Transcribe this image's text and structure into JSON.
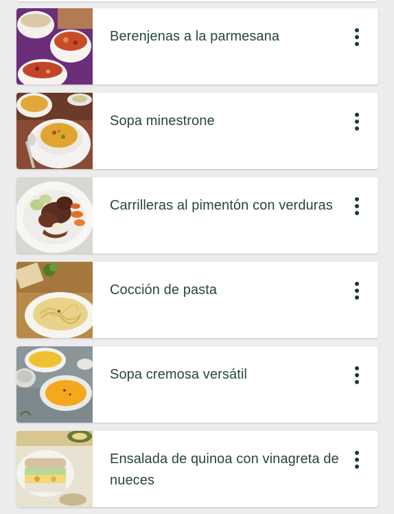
{
  "recipes": [
    {
      "title": "Berenjenas a la parmesana",
      "more_icon": "more-vertical-icon"
    },
    {
      "title": "Sopa minestrone",
      "more_icon": "more-vertical-icon"
    },
    {
      "title": "Carrilleras al pimentón con verduras",
      "more_icon": "more-vertical-icon"
    },
    {
      "title": "Cocción de pasta",
      "more_icon": "more-vertical-icon"
    },
    {
      "title": "Sopa cremosa versátil",
      "more_icon": "more-vertical-icon"
    },
    {
      "title": "Ensalada de quinoa con vinagreta de nueces",
      "more_icon": "more-vertical-icon"
    }
  ],
  "colors": {
    "background": "#ececec",
    "card": "#ffffff",
    "title_text": "#26463a",
    "menu_dots": "#123c2e"
  }
}
